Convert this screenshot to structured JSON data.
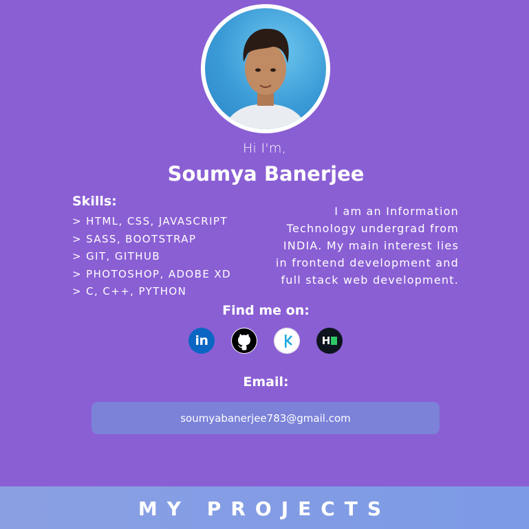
{
  "profile": {
    "greeting": "Hi I'm,",
    "name": "Soumya Banerjee"
  },
  "skills": {
    "title": "Skills:",
    "items": [
      "> HTML, CSS, JAVASCRIPT",
      "> SASS, BOOTSTRAP",
      "> GIT, GITHUB",
      "> PHOTOSHOP, ADOBE XD",
      "> C, C++, PYTHON"
    ]
  },
  "bio": {
    "lines": [
      "I am an Information",
      "Technology undergrad from",
      "INDIA. My main interest lies",
      "in frontend development and",
      "full stack web development."
    ]
  },
  "social": {
    "title": "Find me on:",
    "links": [
      {
        "icon": "linkedin-icon",
        "text": "in",
        "color": "#0a66c2"
      },
      {
        "icon": "github-icon",
        "color": "#000000"
      },
      {
        "icon": "kaggle-icon",
        "color": "#ffffff"
      },
      {
        "icon": "hackerrank-icon",
        "text": "H",
        "color": "#0e141e"
      }
    ]
  },
  "email": {
    "title": "Email:",
    "address": "soumyabanerjee783@gmail.com"
  },
  "projects": {
    "title": "MY PROJECTS"
  },
  "colors": {
    "background": "#8a5fd4",
    "email_box": "#7b82d8",
    "projects_bar": "#8a9fe2"
  }
}
